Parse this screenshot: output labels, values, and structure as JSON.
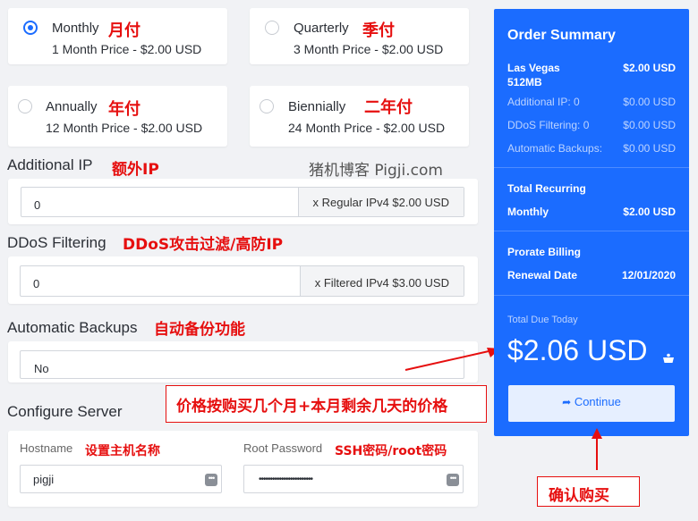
{
  "billing_cycles": [
    {
      "name": "Monthly",
      "price": "1 Month Price - $2.00 USD",
      "note": "月付",
      "checked": true
    },
    {
      "name": "Quarterly",
      "price": "3 Month Price - $2.00 USD",
      "note": "季付",
      "checked": false
    },
    {
      "name": "Annually",
      "price": "12 Month Price - $2.00 USD",
      "note": "年付",
      "checked": false
    },
    {
      "name": "Biennially",
      "price": "24 Month Price - $2.00 USD",
      "note": "二年付",
      "checked": false
    }
  ],
  "additional_ip": {
    "title": "Additional IP",
    "note": "额外IP",
    "value": "0",
    "addon": "x Regular IPv4 $2.00 USD"
  },
  "watermark": "猪机博客 Pigji.com",
  "ddos": {
    "title": "DDoS Filtering",
    "note": "DDoS攻击过滤/高防IP",
    "value": "0",
    "addon": "x Filtered IPv4 $3.00 USD"
  },
  "backups": {
    "title": "Automatic Backups",
    "note": "自动备份功能",
    "value": "No"
  },
  "configure": {
    "title": "Configure Server",
    "hostname_label": "Hostname",
    "hostname_note": "设置主机名称",
    "hostname_value": "pigji",
    "password_label": "Root Password",
    "password_note": "SSH密码/root密码",
    "password_value": "••••••••••••••••••••••••"
  },
  "price_note": "价格按购买几个月+本月剩余几天的价格",
  "confirm_note": "确认购买",
  "summary": {
    "title": "Order Summary",
    "product": "Las Vegas",
    "product_sub": "512MB",
    "product_price": "$2.00 USD",
    "lines": [
      {
        "label": "Additional IP: 0",
        "value": "$0.00 USD"
      },
      {
        "label": "DDoS Filtering: 0",
        "value": "$0.00 USD"
      },
      {
        "label": "Automatic Backups:",
        "value": "$0.00 USD"
      }
    ],
    "recurring_title": "Total Recurring",
    "recurring_label": "Monthly",
    "recurring_value": "$2.00 USD",
    "prorate_title": "Prorate Billing",
    "renewal_label": "Renewal Date",
    "renewal_value": "12/01/2020",
    "due_label": "Total Due Today",
    "due_amount": "$2.06 USD",
    "continue_label": "Continue"
  },
  "colors": {
    "accent": "#1b6cff",
    "annotation": "#e60f0f"
  }
}
